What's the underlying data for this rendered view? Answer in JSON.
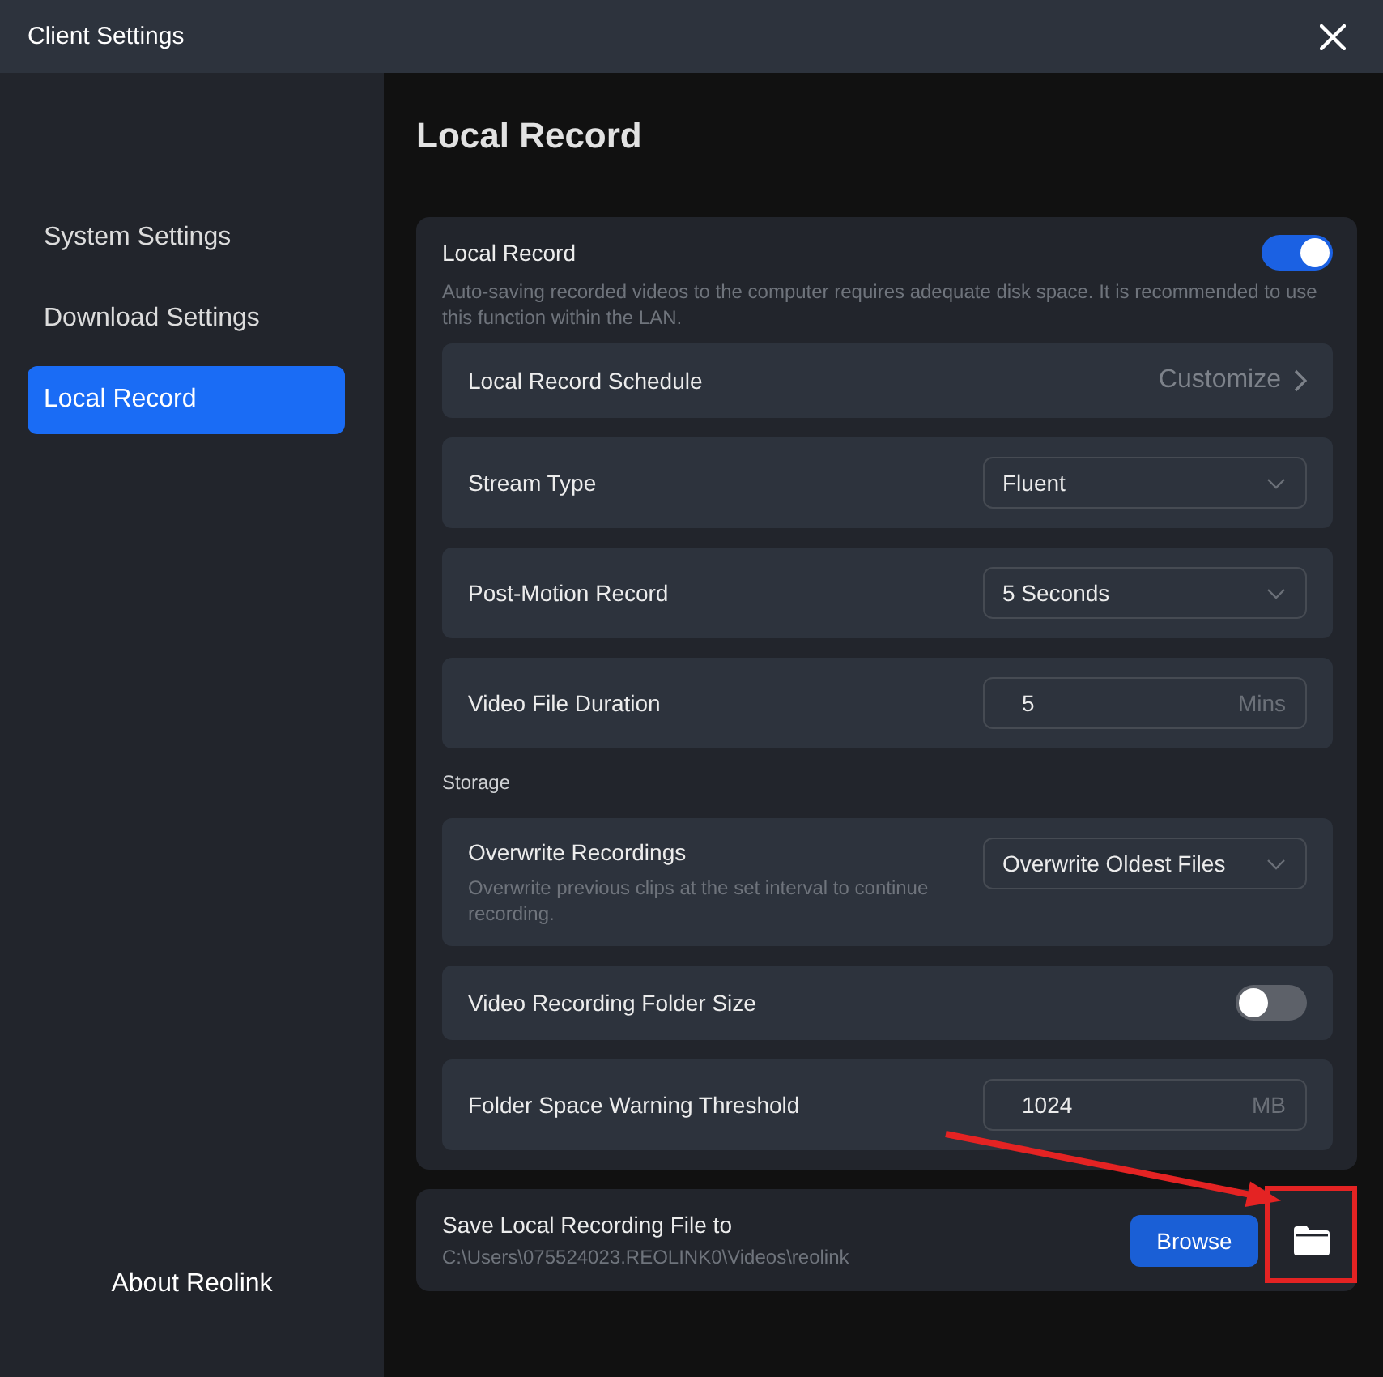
{
  "window": {
    "title": "Client Settings"
  },
  "sidebar": {
    "items": [
      {
        "label": "System Settings",
        "selected": false
      },
      {
        "label": "Download Settings",
        "selected": false
      },
      {
        "label": "Local Record",
        "selected": true
      }
    ],
    "footer": "About Reolink"
  },
  "page": {
    "title": "Local Record"
  },
  "local_record": {
    "label": "Local Record",
    "on": true,
    "description": "Auto-saving recorded videos to the computer requires adequate disk space. It is recommended to use this function within the LAN.",
    "rows": [
      {
        "kind": "link",
        "label": "Local Record Schedule",
        "value": "Customize"
      },
      {
        "kind": "select",
        "label": "Stream Type",
        "value": "Fluent"
      },
      {
        "kind": "select",
        "label": "Post-Motion Record",
        "value": "5 Seconds"
      },
      {
        "kind": "input",
        "label": "Video File Duration",
        "value": "5",
        "unit": "Mins"
      },
      {
        "kind": "heading",
        "label": "Storage"
      },
      {
        "kind": "select",
        "label": "Overwrite Recordings",
        "description": "Overwrite previous clips at the set interval to continue recording.",
        "value": "Overwrite Oldest Files"
      },
      {
        "kind": "toggle",
        "label": "Video Recording Folder Size",
        "on": false
      },
      {
        "kind": "input",
        "label": "Folder Space Warning Threshold",
        "value": "1024",
        "unit": "MB"
      }
    ]
  },
  "save_location": {
    "label": "Save Local Recording File to",
    "path": "C:\\Users\\075524023.REOLINK0\\Videos\\reolink",
    "button": "Browse"
  },
  "annotations": {
    "arrow": true,
    "highlight_frame": true
  }
}
